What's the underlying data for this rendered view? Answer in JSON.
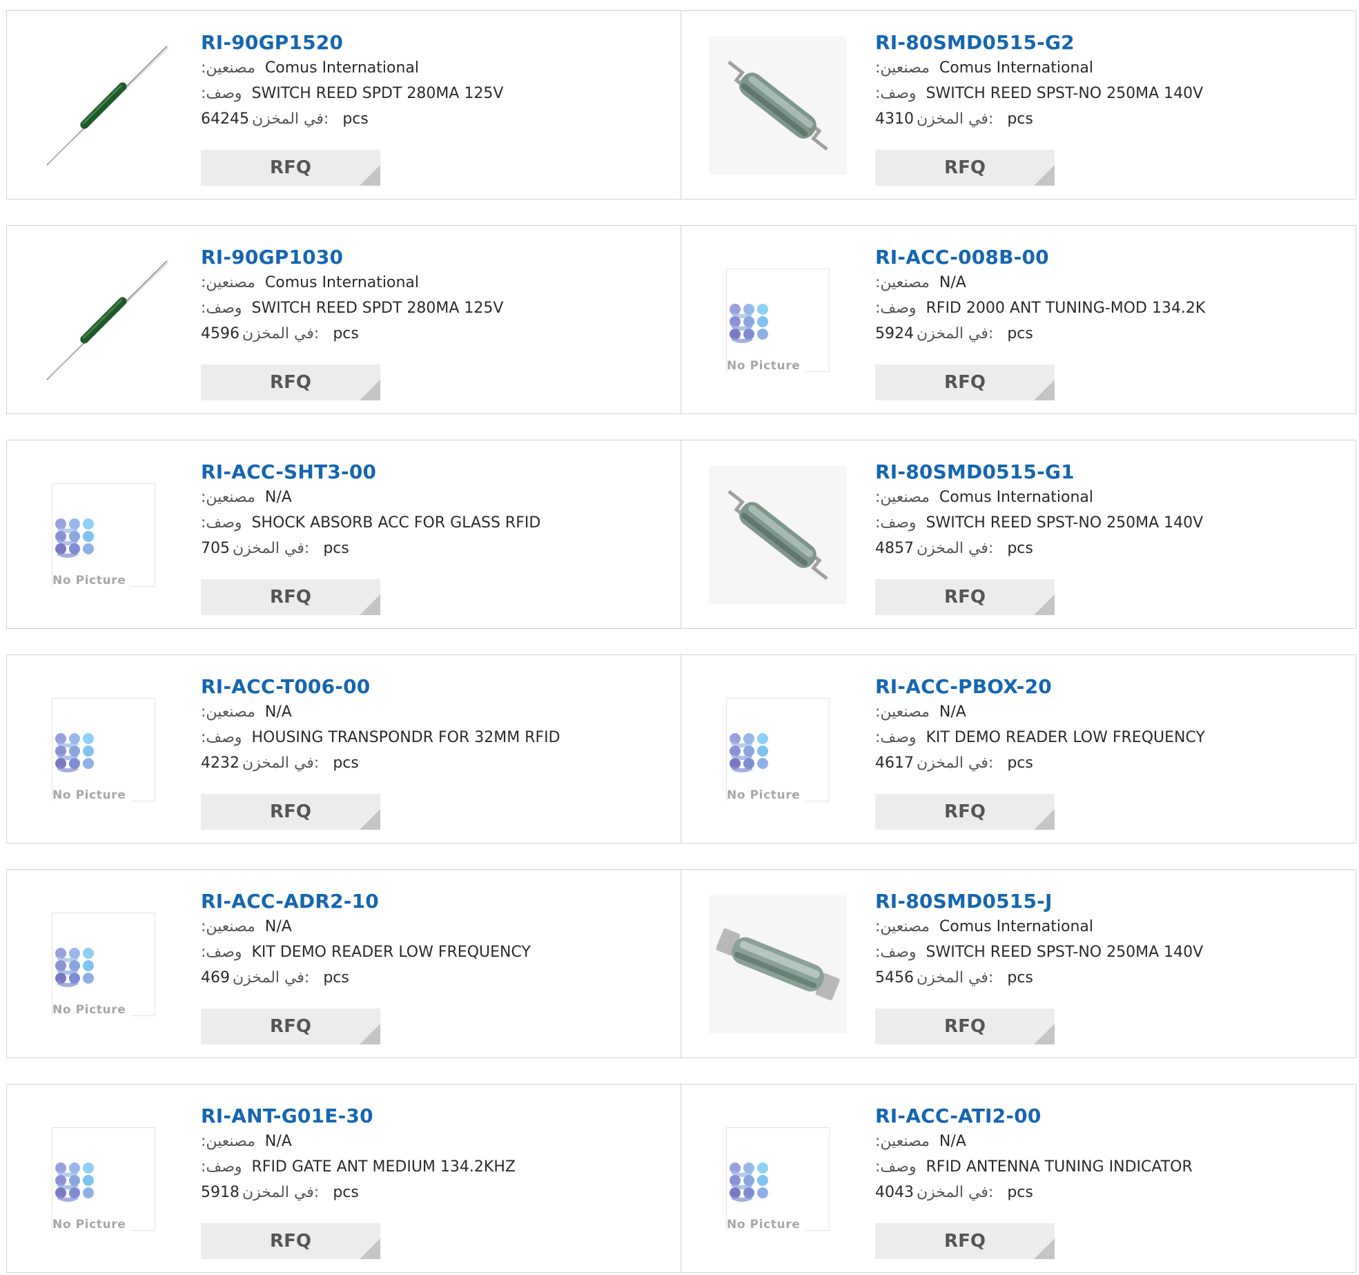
{
  "labels": {
    "manufacturer": ":مصنعين",
    "description": ":وصف",
    "stock": "في المخزن:",
    "pcs": "pcs",
    "rfq": "RFQ",
    "no_picture": "No Picture"
  },
  "colors": {
    "link": "#1466b0",
    "button_bg": "#ececec",
    "border": "#d4d4d4"
  },
  "products": [
    {
      "part": "RI-90GP1520",
      "manufacturer": "Comus International",
      "description": "SWITCH REED SPDT 280MA 125V",
      "stock": "64245",
      "image": "reed-switch-axial"
    },
    {
      "part": "RI-80SMD0515-G2",
      "manufacturer": "Comus International",
      "description": "SWITCH REED SPST-NO 250MA 140V",
      "stock": "4310",
      "image": "reed-switch-smd"
    },
    {
      "part": "RI-90GP1030",
      "manufacturer": "Comus International",
      "description": "SWITCH REED SPDT 280MA 125V",
      "stock": "4596",
      "image": "reed-switch-axial"
    },
    {
      "part": "RI-ACC-008B-00",
      "manufacturer": "N/A",
      "description": "RFID 2000 ANT TUNING-MOD 134.2K",
      "stock": "5924",
      "image": "no-picture"
    },
    {
      "part": "RI-ACC-SHT3-00",
      "manufacturer": "N/A",
      "description": "SHOCK ABSORB ACC FOR GLASS RFID",
      "stock": "705",
      "image": "no-picture"
    },
    {
      "part": "RI-80SMD0515-G1",
      "manufacturer": "Comus International",
      "description": "SWITCH REED SPST-NO 250MA 140V",
      "stock": "4857",
      "image": "reed-switch-smd"
    },
    {
      "part": "RI-ACC-T006-00",
      "manufacturer": "N/A",
      "description": "HOUSING TRANSPONDR FOR 32MM RFID",
      "stock": "4232",
      "image": "no-picture"
    },
    {
      "part": "RI-ACC-PBOX-20",
      "manufacturer": "N/A",
      "description": "KIT DEMO READER LOW FREQUENCY",
      "stock": "4617",
      "image": "no-picture"
    },
    {
      "part": "RI-ACC-ADR2-10",
      "manufacturer": "N/A",
      "description": "KIT DEMO READER LOW FREQUENCY",
      "stock": "469",
      "image": "no-picture"
    },
    {
      "part": "RI-80SMD0515-J",
      "manufacturer": "Comus International",
      "description": "SWITCH REED SPST-NO 250MA 140V",
      "stock": "5456",
      "image": "reed-switch-smd-j"
    },
    {
      "part": "RI-ANT-G01E-30",
      "manufacturer": "N/A",
      "description": "RFID GATE ANT MEDIUM 134.2KHZ",
      "stock": "5918",
      "image": "no-picture"
    },
    {
      "part": "RI-ACC-ATI2-00",
      "manufacturer": "N/A",
      "description": "RFID ANTENNA TUNING INDICATOR",
      "stock": "4043",
      "image": "no-picture"
    }
  ]
}
